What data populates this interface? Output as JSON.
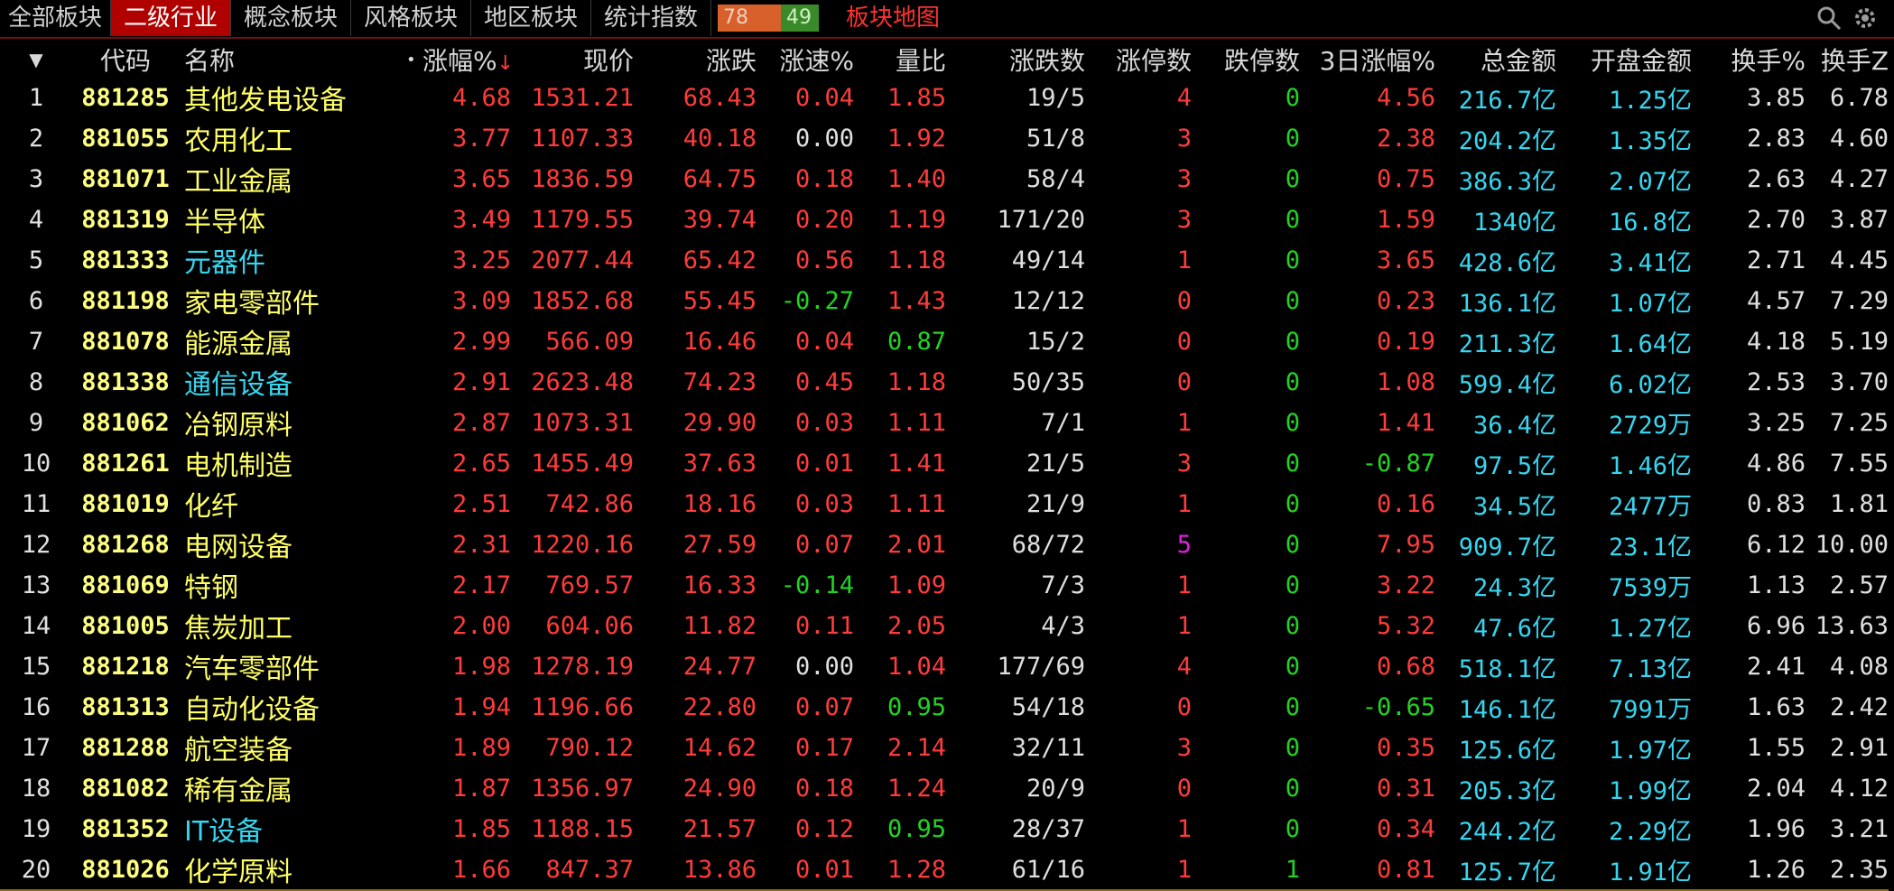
{
  "tabs": [
    "全部板块",
    "二级行业",
    "概念板块",
    "风格板块",
    "地区板块",
    "统计指数"
  ],
  "active_tab": 1,
  "ratio": {
    "up": "78",
    "down": "49"
  },
  "map_link": "板块地图",
  "icons": [
    "search-icon",
    "gear-icon"
  ],
  "columns": {
    "menu": "▼",
    "code": "代码",
    "name": "名称",
    "dot": "•",
    "pct": "涨幅%",
    "sort_mark": "↓",
    "price": "现价",
    "change": "涨跌",
    "speed": "涨速%",
    "vol_ratio": "量比",
    "updown": "涨跌数",
    "limit_up": "涨停数",
    "limit_down": "跌停数",
    "pct3d": "3日涨幅%",
    "amount": "总金额",
    "open_amount": "开盘金额",
    "turnover": "换手%",
    "turnover2": "换手Z"
  },
  "rows": [
    {
      "idx": "1",
      "code": "881285",
      "name": "其他发电设备",
      "name_color": "yel",
      "pct": "4.68",
      "price": "1531.21",
      "change": "68.43",
      "speed": "0.04",
      "speed_color": "red",
      "vr": "1.85",
      "vr_color": "red",
      "ud": "19/5",
      "lu": "4",
      "lu_color": "red",
      "ld": "0",
      "p3": "4.56",
      "p3_color": "red",
      "amt": "216.7亿",
      "oamt": "1.25亿",
      "to": "3.85",
      "to2": "6.78"
    },
    {
      "idx": "2",
      "code": "881055",
      "name": "农用化工",
      "name_color": "yel",
      "pct": "3.77",
      "price": "1107.33",
      "change": "40.18",
      "speed": "0.00",
      "speed_color": "wht",
      "vr": "1.92",
      "vr_color": "red",
      "ud": "51/8",
      "lu": "3",
      "lu_color": "red",
      "ld": "0",
      "p3": "2.38",
      "p3_color": "red",
      "amt": "204.2亿",
      "oamt": "1.35亿",
      "to": "2.83",
      "to2": "4.60"
    },
    {
      "idx": "3",
      "code": "881071",
      "name": "工业金属",
      "name_color": "yel",
      "pct": "3.65",
      "price": "1836.59",
      "change": "64.75",
      "speed": "0.18",
      "speed_color": "red",
      "vr": "1.40",
      "vr_color": "red",
      "ud": "58/4",
      "lu": "3",
      "lu_color": "red",
      "ld": "0",
      "p3": "0.75",
      "p3_color": "red",
      "amt": "386.3亿",
      "oamt": "2.07亿",
      "to": "2.63",
      "to2": "4.27"
    },
    {
      "idx": "4",
      "code": "881319",
      "name": "半导体",
      "name_color": "yel",
      "pct": "3.49",
      "price": "1179.55",
      "change": "39.74",
      "speed": "0.20",
      "speed_color": "red",
      "vr": "1.19",
      "vr_color": "red",
      "ud": "171/20",
      "lu": "3",
      "lu_color": "red",
      "ld": "0",
      "p3": "1.59",
      "p3_color": "red",
      "amt": "1340亿",
      "oamt": "16.8亿",
      "to": "2.70",
      "to2": "3.87"
    },
    {
      "idx": "5",
      "code": "881333",
      "name": "元器件",
      "name_color": "cyan",
      "pct": "3.25",
      "price": "2077.44",
      "change": "65.42",
      "speed": "0.56",
      "speed_color": "red",
      "vr": "1.18",
      "vr_color": "red",
      "ud": "49/14",
      "lu": "1",
      "lu_color": "red",
      "ld": "0",
      "p3": "3.65",
      "p3_color": "red",
      "amt": "428.6亿",
      "oamt": "3.41亿",
      "to": "2.71",
      "to2": "4.45"
    },
    {
      "idx": "6",
      "code": "881198",
      "name": "家电零部件",
      "name_color": "yel",
      "pct": "3.09",
      "price": "1852.68",
      "change": "55.45",
      "speed": "-0.27",
      "speed_color": "grn",
      "vr": "1.43",
      "vr_color": "red",
      "ud": "12/12",
      "lu": "0",
      "lu_color": "red",
      "ld": "0",
      "p3": "0.23",
      "p3_color": "red",
      "amt": "136.1亿",
      "oamt": "1.07亿",
      "to": "4.57",
      "to2": "7.29"
    },
    {
      "idx": "7",
      "code": "881078",
      "name": "能源金属",
      "name_color": "yel",
      "pct": "2.99",
      "price": "566.09",
      "change": "16.46",
      "speed": "0.04",
      "speed_color": "red",
      "vr": "0.87",
      "vr_color": "grn",
      "ud": "15/2",
      "lu": "0",
      "lu_color": "red",
      "ld": "0",
      "p3": "0.19",
      "p3_color": "red",
      "amt": "211.3亿",
      "oamt": "1.64亿",
      "to": "4.18",
      "to2": "5.19"
    },
    {
      "idx": "8",
      "code": "881338",
      "name": "通信设备",
      "name_color": "cyan",
      "pct": "2.91",
      "price": "2623.48",
      "change": "74.23",
      "speed": "0.45",
      "speed_color": "red",
      "vr": "1.18",
      "vr_color": "red",
      "ud": "50/35",
      "lu": "0",
      "lu_color": "red",
      "ld": "0",
      "p3": "1.08",
      "p3_color": "red",
      "amt": "599.4亿",
      "oamt": "6.02亿",
      "to": "2.53",
      "to2": "3.70"
    },
    {
      "idx": "9",
      "code": "881062",
      "name": "冶钢原料",
      "name_color": "yel",
      "pct": "2.87",
      "price": "1073.31",
      "change": "29.90",
      "speed": "0.03",
      "speed_color": "red",
      "vr": "1.11",
      "vr_color": "red",
      "ud": "7/1",
      "lu": "1",
      "lu_color": "red",
      "ld": "0",
      "p3": "1.41",
      "p3_color": "red",
      "amt": "36.4亿",
      "oamt": "2729万",
      "to": "3.25",
      "to2": "7.25"
    },
    {
      "idx": "10",
      "code": "881261",
      "name": "电机制造",
      "name_color": "yel",
      "pct": "2.65",
      "price": "1455.49",
      "change": "37.63",
      "speed": "0.01",
      "speed_color": "red",
      "vr": "1.41",
      "vr_color": "red",
      "ud": "21/5",
      "lu": "3",
      "lu_color": "red",
      "ld": "0",
      "p3": "-0.87",
      "p3_color": "grn",
      "amt": "97.5亿",
      "oamt": "1.46亿",
      "to": "4.86",
      "to2": "7.55"
    },
    {
      "idx": "11",
      "code": "881019",
      "name": "化纤",
      "name_color": "yel",
      "pct": "2.51",
      "price": "742.86",
      "change": "18.16",
      "speed": "0.03",
      "speed_color": "red",
      "vr": "1.11",
      "vr_color": "red",
      "ud": "21/9",
      "lu": "1",
      "lu_color": "red",
      "ld": "0",
      "p3": "0.16",
      "p3_color": "red",
      "amt": "34.5亿",
      "oamt": "2477万",
      "to": "0.83",
      "to2": "1.81"
    },
    {
      "idx": "12",
      "code": "881268",
      "name": "电网设备",
      "name_color": "yel",
      "pct": "2.31",
      "price": "1220.16",
      "change": "27.59",
      "speed": "0.07",
      "speed_color": "red",
      "vr": "2.01",
      "vr_color": "red",
      "ud": "68/72",
      "lu": "5",
      "lu_color": "mag",
      "ld": "0",
      "p3": "7.95",
      "p3_color": "red",
      "amt": "909.7亿",
      "oamt": "23.1亿",
      "to": "6.12",
      "to2": "10.00"
    },
    {
      "idx": "13",
      "code": "881069",
      "name": "特钢",
      "name_color": "yel",
      "pct": "2.17",
      "price": "769.57",
      "change": "16.33",
      "speed": "-0.14",
      "speed_color": "grn",
      "vr": "1.09",
      "vr_color": "red",
      "ud": "7/3",
      "lu": "1",
      "lu_color": "red",
      "ld": "0",
      "p3": "3.22",
      "p3_color": "red",
      "amt": "24.3亿",
      "oamt": "7539万",
      "to": "1.13",
      "to2": "2.57"
    },
    {
      "idx": "14",
      "code": "881005",
      "name": "焦炭加工",
      "name_color": "yel",
      "pct": "2.00",
      "price": "604.06",
      "change": "11.82",
      "speed": "0.11",
      "speed_color": "red",
      "vr": "2.05",
      "vr_color": "red",
      "ud": "4/3",
      "lu": "1",
      "lu_color": "red",
      "ld": "0",
      "p3": "5.32",
      "p3_color": "red",
      "amt": "47.6亿",
      "oamt": "1.27亿",
      "to": "6.96",
      "to2": "13.63"
    },
    {
      "idx": "15",
      "code": "881218",
      "name": "汽车零部件",
      "name_color": "yel",
      "pct": "1.98",
      "price": "1278.19",
      "change": "24.77",
      "speed": "0.00",
      "speed_color": "wht",
      "vr": "1.04",
      "vr_color": "red",
      "ud": "177/69",
      "lu": "4",
      "lu_color": "red",
      "ld": "0",
      "p3": "0.68",
      "p3_color": "red",
      "amt": "518.1亿",
      "oamt": "7.13亿",
      "to": "2.41",
      "to2": "4.08"
    },
    {
      "idx": "16",
      "code": "881313",
      "name": "自动化设备",
      "name_color": "yel",
      "pct": "1.94",
      "price": "1196.66",
      "change": "22.80",
      "speed": "0.07",
      "speed_color": "red",
      "vr": "0.95",
      "vr_color": "grn",
      "ud": "54/18",
      "lu": "0",
      "lu_color": "red",
      "ld": "0",
      "p3": "-0.65",
      "p3_color": "grn",
      "amt": "146.1亿",
      "oamt": "7991万",
      "to": "1.63",
      "to2": "2.42"
    },
    {
      "idx": "17",
      "code": "881288",
      "name": "航空装备",
      "name_color": "yel",
      "pct": "1.89",
      "price": "790.12",
      "change": "14.62",
      "speed": "0.17",
      "speed_color": "red",
      "vr": "2.14",
      "vr_color": "red",
      "ud": "32/11",
      "lu": "3",
      "lu_color": "red",
      "ld": "0",
      "p3": "0.35",
      "p3_color": "red",
      "amt": "125.6亿",
      "oamt": "1.97亿",
      "to": "1.55",
      "to2": "2.91"
    },
    {
      "idx": "18",
      "code": "881082",
      "name": "稀有金属",
      "name_color": "yel",
      "pct": "1.87",
      "price": "1356.97",
      "change": "24.90",
      "speed": "0.18",
      "speed_color": "red",
      "vr": "1.24",
      "vr_color": "red",
      "ud": "20/9",
      "lu": "0",
      "lu_color": "red",
      "ld": "0",
      "p3": "0.31",
      "p3_color": "red",
      "amt": "205.3亿",
      "oamt": "1.99亿",
      "to": "2.04",
      "to2": "4.12"
    },
    {
      "idx": "19",
      "code": "881352",
      "name": "IT设备",
      "name_color": "cyan",
      "pct": "1.85",
      "price": "1188.15",
      "change": "21.57",
      "speed": "0.12",
      "speed_color": "red",
      "vr": "0.95",
      "vr_color": "grn",
      "ud": "28/37",
      "lu": "1",
      "lu_color": "red",
      "ld": "0",
      "p3": "0.34",
      "p3_color": "red",
      "amt": "244.2亿",
      "oamt": "2.29亿",
      "to": "1.96",
      "to2": "3.21"
    },
    {
      "idx": "20",
      "code": "881026",
      "name": "化学原料",
      "name_color": "yel",
      "pct": "1.66",
      "price": "847.37",
      "change": "13.86",
      "speed": "0.01",
      "speed_color": "red",
      "vr": "1.28",
      "vr_color": "red",
      "ud": "61/16",
      "lu": "1",
      "lu_color": "red",
      "ld": "1",
      "p3": "0.81",
      "p3_color": "red",
      "amt": "125.7亿",
      "oamt": "1.91亿",
      "to": "1.26",
      "to2": "2.35"
    }
  ]
}
